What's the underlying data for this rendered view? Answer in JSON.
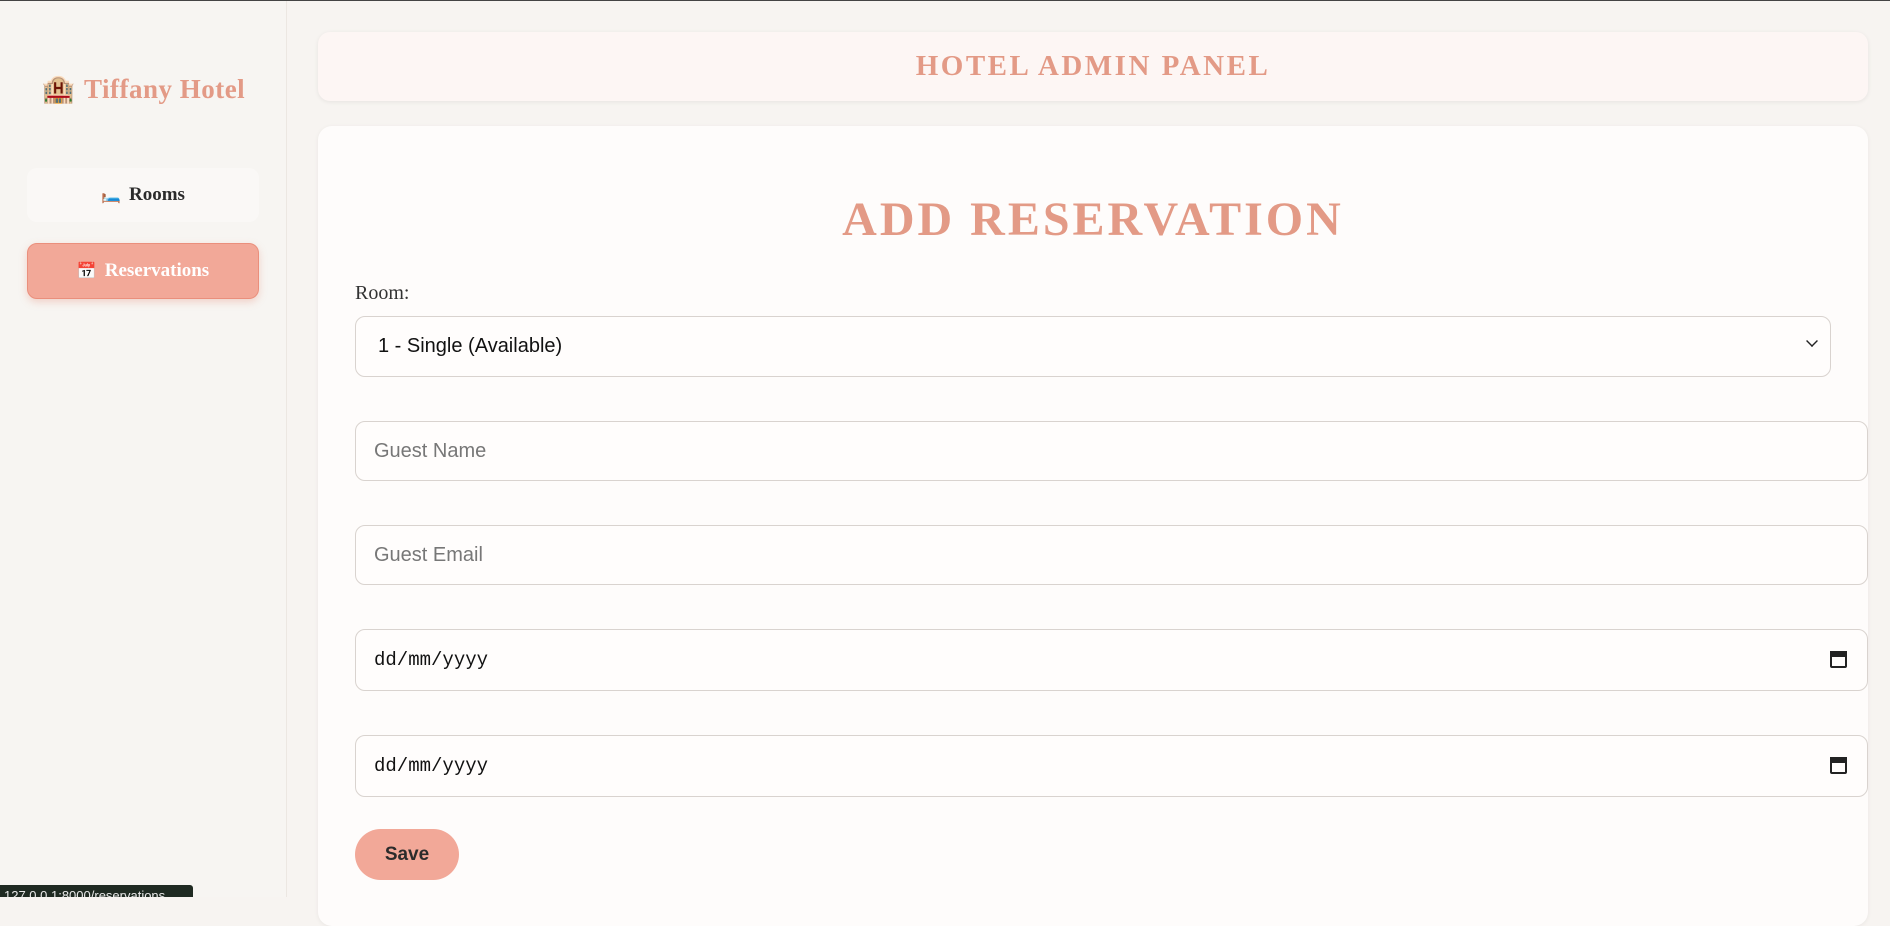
{
  "sidebar": {
    "brand": {
      "icon": "🏨",
      "icon_name": "hotel-icon",
      "title": "Tiffany Hotel"
    },
    "items": [
      {
        "icon": "🛏️",
        "icon_name": "bed-icon",
        "label": "Rooms",
        "active": false
      },
      {
        "icon": "📅",
        "icon_name": "calendar-icon",
        "label": "Reservations",
        "active": true
      }
    ]
  },
  "header": {
    "title": "HOTEL ADMIN PANEL"
  },
  "form": {
    "title": "ADD RESERVATION",
    "room_label": "Room:",
    "room_selected": "1 - Single (Available)",
    "guest_name_placeholder": "Guest Name",
    "guest_email_placeholder": "Guest Email",
    "check_in_placeholder": "dd/mm/yyyy",
    "check_out_placeholder": "dd/mm/yyyy",
    "save_label": "Save"
  },
  "status_bar": {
    "url": "127.0.0.1:8000/reservations"
  },
  "colors": {
    "accent": "#e39a86",
    "button": "#f2a898",
    "background": "#f7f4f1"
  }
}
